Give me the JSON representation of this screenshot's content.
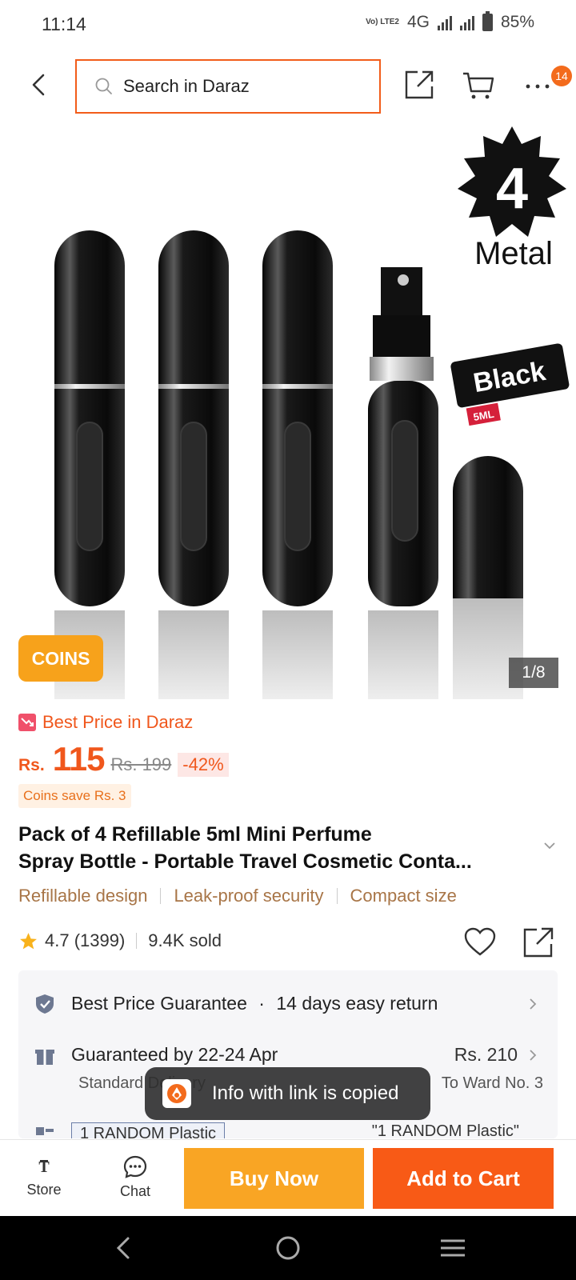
{
  "status": {
    "time": "11:14",
    "volte": "Vo) LTE2",
    "network": "4G",
    "battery": "85%"
  },
  "header": {
    "search_placeholder": "Search in Daraz",
    "cart_badge": "14"
  },
  "gallery": {
    "pack_count": "4",
    "material": "Metal",
    "color_label": "Black",
    "volume_label": "5ML",
    "coins_chip": "COINS",
    "counter": "1/8"
  },
  "price": {
    "best_price_label": "Best Price in Daraz",
    "currency": "Rs.",
    "current": "115",
    "original": "Rs. 199",
    "discount": "-42%",
    "coins_save": "Coins save Rs. 3"
  },
  "product": {
    "title_line1": "Pack of 4 Refillable 5ml Mini Perfume",
    "title_line2": "Spray Bottle - Portable Travel Cosmetic Conta...",
    "features": [
      "Refillable design",
      "Leak-proof security",
      "Compact size"
    ],
    "rating": "4.7 (1399)",
    "sold": "9.4K sold"
  },
  "service": {
    "guarantee": "Best Price Guarantee",
    "returns": "14 days easy return",
    "delivery_date": "Guaranteed by 22-24 Apr",
    "delivery_price": "Rs. 210",
    "delivery_type": "Standard Delivery",
    "delivery_to": "To Ward No. 3",
    "variant_chip": "1 RANDOM Plastic",
    "variant_selected": "\"1 RANDOM Plastic\""
  },
  "toast": {
    "message": "Info with link is copied"
  },
  "actions": {
    "store": "Store",
    "chat": "Chat",
    "buy_now": "Buy Now",
    "add_to_cart": "Add to Cart"
  },
  "colors": {
    "brand_orange": "#f85a16",
    "buy_yellow": "#f9a524",
    "price_orange": "#f0571c"
  }
}
